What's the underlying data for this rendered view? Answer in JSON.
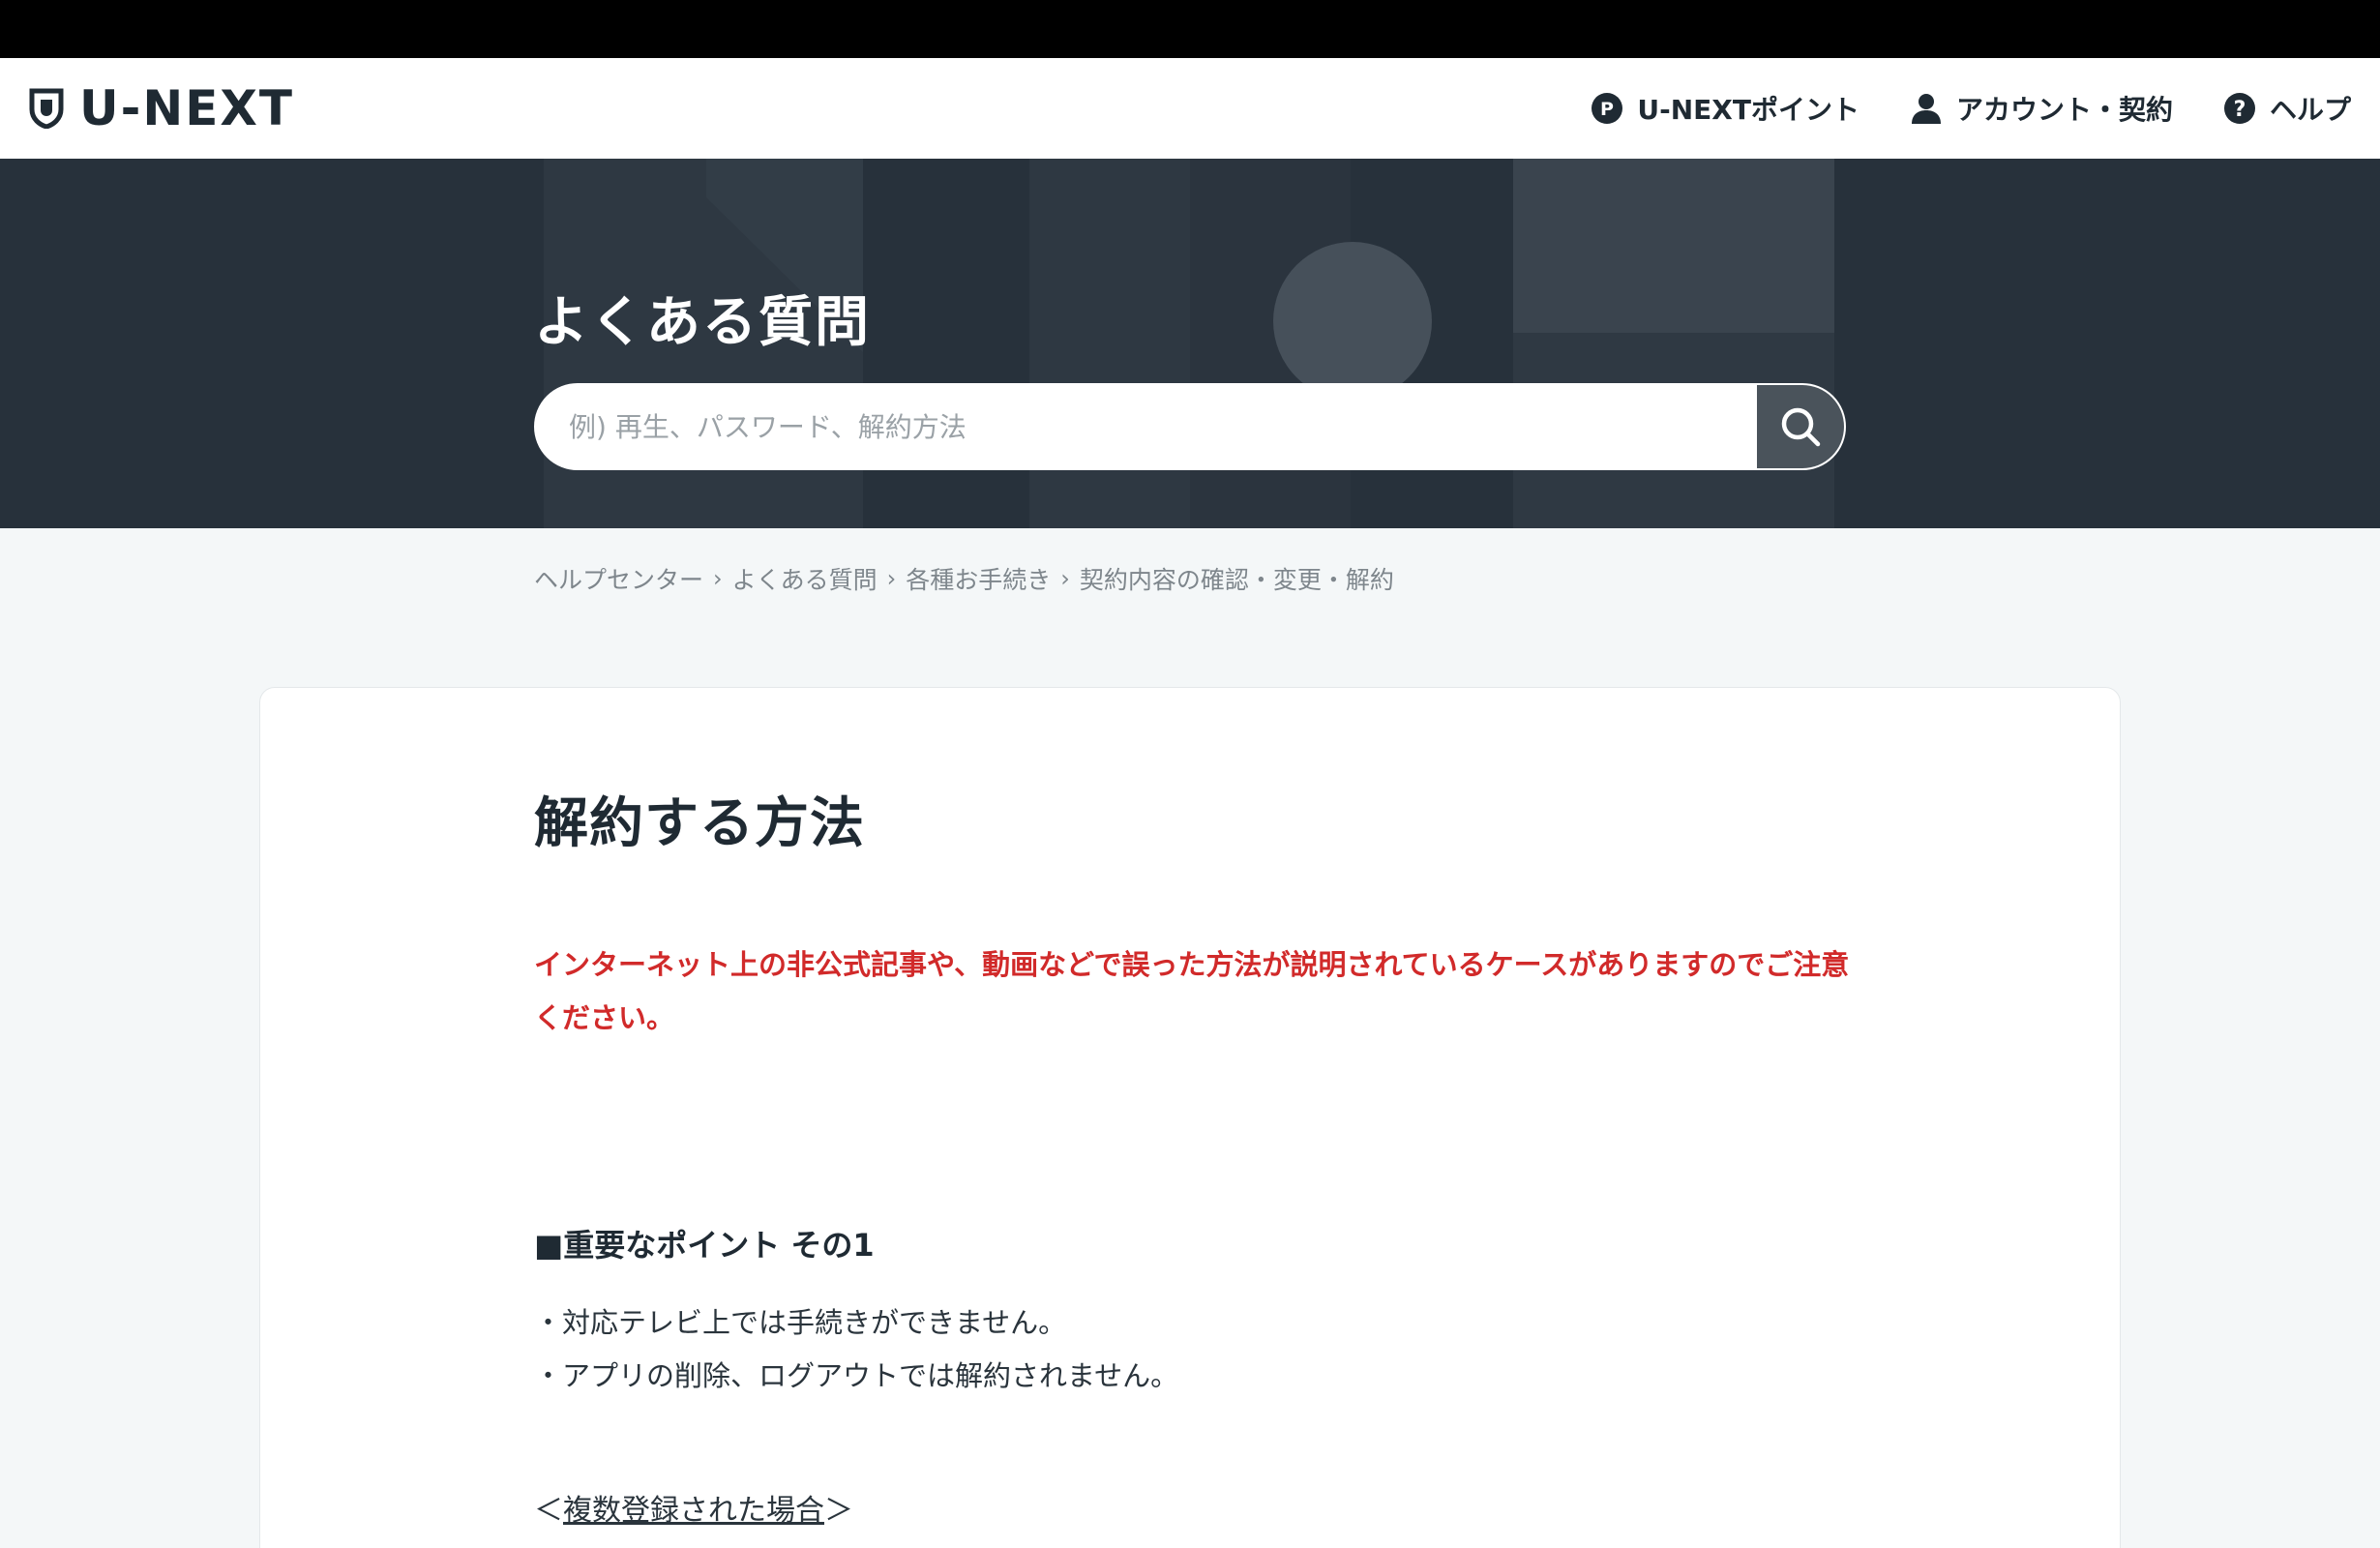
{
  "header": {
    "logo_text": "U-NEXT",
    "nav": [
      {
        "label": "U-NEXTポイント",
        "icon": "points-icon"
      },
      {
        "label": "アカウント・契約",
        "icon": "account-icon"
      },
      {
        "label": "ヘルプ",
        "icon": "help-icon"
      }
    ]
  },
  "hero": {
    "title": "よくある質問",
    "search_placeholder": "例) 再生、パスワード、解約方法",
    "search_value": ""
  },
  "breadcrumb": [
    "ヘルプセンター",
    "よくある質問",
    "各種お手続き",
    "契約内容の確認・変更・解約"
  ],
  "article": {
    "title": "解約する方法",
    "warning": "インターネット上の非公式記事や、動画などで誤った方法が説明されているケースがありますのでご注意ください。",
    "point_heading": "■重要なポイント その1",
    "bullets": [
      "・対応テレビ上では手続きができません。",
      "・アプリの削除、ログアウトでは解約されません。"
    ],
    "subhead_open": "＜",
    "subhead_link": "複数登録された場合",
    "subhead_close": "＞"
  },
  "colors": {
    "hero_bg": "#27313b",
    "warning": "#d12a2a",
    "search_button": "#4a535b"
  }
}
